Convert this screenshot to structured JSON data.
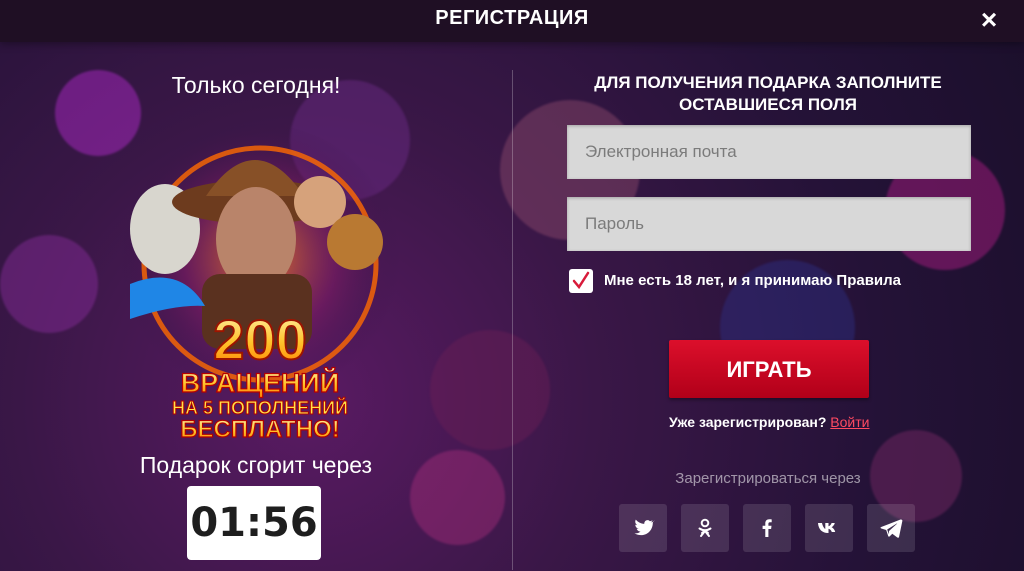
{
  "header": {
    "title": "РЕГИСТРАЦИЯ",
    "close_symbol": "×"
  },
  "left": {
    "offer_text": "Только сегодня!",
    "promo": {
      "number": "200",
      "line1": "ВРАЩЕНИЙ",
      "line2": "НА 5 ПОПОЛНЕНИЙ",
      "line3": "БЕСПЛАТНО!"
    },
    "gift_text": "Подарок сгорит через",
    "timer": "01:56"
  },
  "form": {
    "heading_line1": "ДЛЯ ПОЛУЧЕНИЯ ПОДАРКА ЗАПОЛНИТЕ",
    "heading_line2": "ОСТАВШИЕСЯ ПОЛЯ",
    "email_placeholder": "Электронная почта",
    "password_placeholder": "Пароль",
    "agreement_text": "Мне есть 18 лет, и я принимаю Правила",
    "play_button": "ИГРАТЬ",
    "already_registered": "Уже зарегистрирован?",
    "login_link": "Войти",
    "social_title": "Зарегистрироваться через"
  },
  "social_icons": [
    "twitter-icon",
    "odnoklassniki-icon",
    "facebook-icon",
    "vk-icon",
    "telegram-icon"
  ],
  "colors": {
    "header_bg": "#1f0f24",
    "play_button": "#d60f2b",
    "link": "#ff4a62",
    "checkbox_check": "#d81b3a"
  }
}
